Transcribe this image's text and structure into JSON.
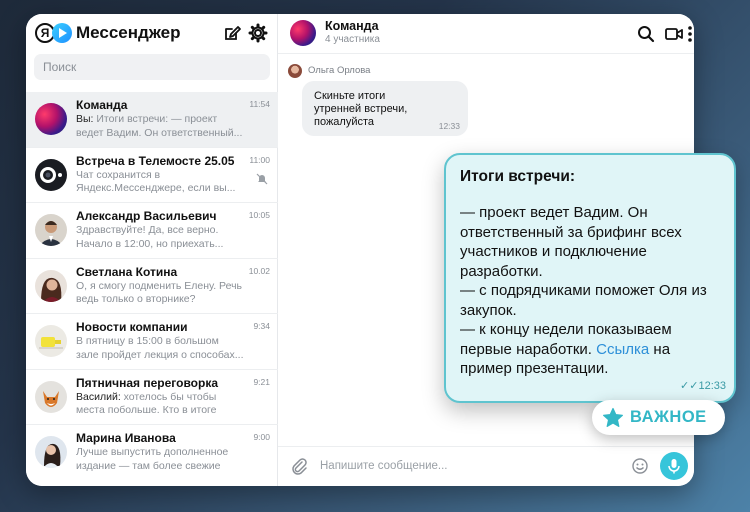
{
  "app": {
    "logo_letter": "Я",
    "title": "Мессенджер"
  },
  "search": {
    "placeholder": "Поиск"
  },
  "chats": [
    {
      "name": "Команда",
      "time": "11:54",
      "sender": "Вы:",
      "preview": " Итоги встречи: — проект ведет Вадим. Он ответственный...",
      "avatar": "gradient-art"
    },
    {
      "name": "Встреча в Телемосте 25.05 ...",
      "time": "11:00",
      "sender": "",
      "preview": "Чат сохранится в Яндекс.Мессенджере, если вы...",
      "muted": true,
      "avatar": "camera-icon"
    },
    {
      "name": "Александр Васильевич",
      "time": "10:05",
      "sender": "",
      "preview": "Здравствуйте! Да, все верно. Начало в 12:00, но приехать...",
      "avatar": "man-photo"
    },
    {
      "name": "Светлана Котина",
      "time": "10.02",
      "sender": "",
      "preview": "О, я смогу подменить Елену. Речь ведь только о вторнике?",
      "avatar": "woman-photo"
    },
    {
      "name": "Новости компании",
      "time": "9:34",
      "sender": "",
      "preview": "В пятницу в 15:00 в большом зале пройдет лекция о способах...",
      "avatar": "lamp-photo"
    },
    {
      "name": "Пятничная переговорка",
      "time": "9:21",
      "sender": "Василий:",
      "preview": " хотелось бы чтобы места побольше. Кто в итоге точно...",
      "avatar": "fox-photo"
    },
    {
      "name": "Марина Иванова",
      "time": "9:00",
      "sender": "",
      "preview": "Лучше выпустить дополненное издание — там более свежие да...",
      "avatar": "woman2-photo"
    }
  ],
  "chat_header": {
    "title": "Команда",
    "subtitle": "4 участника"
  },
  "message": {
    "sender": "Ольга Орлова",
    "text": "Скиньте итоги утренней встречи, пожалуйста",
    "time": "12:33"
  },
  "composer": {
    "placeholder": "Напишите сообщение..."
  },
  "highlight": {
    "title": "Итоги встречи:",
    "body_before_link": "— проект ведет Вадим. Он ответственный за брифинг всех участников и подключение разработки.\n— с подрядчиками поможет Оля из закупок.\n— к концу недели показываем первые наработки. ",
    "link": "Ссылка",
    "body_after_link": " на пример презентации.",
    "time": "12:33",
    "read_mark": "✓✓"
  },
  "badge": {
    "label": "ВАЖНОЕ"
  },
  "colors": {
    "accent": "#36c5da",
    "callout_bg": "#e0f5f7",
    "callout_border": "#5fc4cf",
    "link": "#2d8fd8"
  }
}
